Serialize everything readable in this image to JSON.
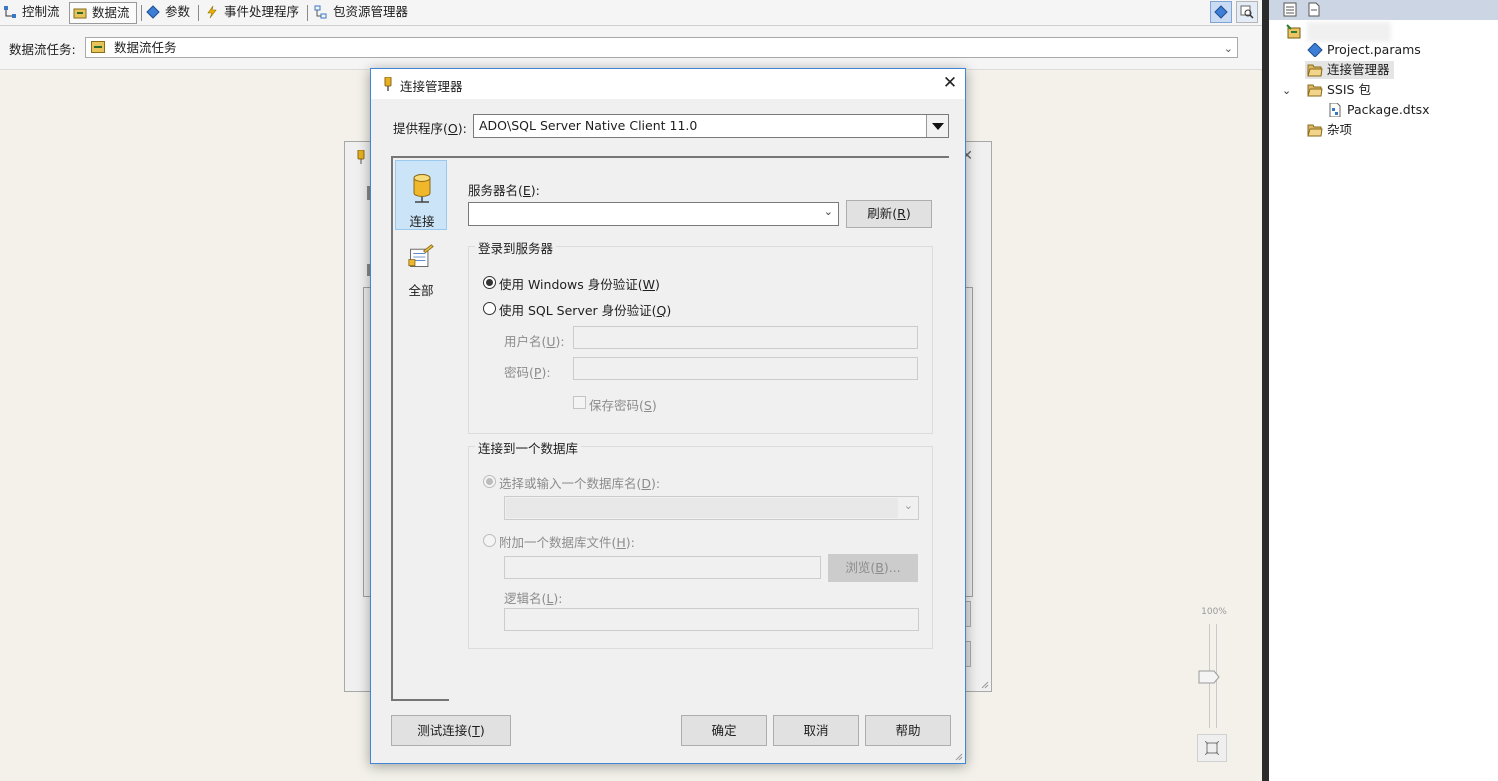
{
  "designer": {
    "tabs": [
      {
        "label": "控制流",
        "icon": "control-flow-icon"
      },
      {
        "label": "数据流",
        "icon": "data-flow-icon"
      },
      {
        "label": "参数",
        "icon": "parameters-icon"
      },
      {
        "label": "事件处理程序",
        "icon": "event-handler-icon"
      },
      {
        "label": "包资源管理器",
        "icon": "package-explorer-icon"
      }
    ],
    "active_tab": "数据流",
    "task_label": "数据流任务:",
    "task_value": "数据流任务",
    "zoom_label": "100%"
  },
  "solution_explorer": {
    "items": [
      {
        "label": "Project.params",
        "icon": "params-icon"
      },
      {
        "label": "连接管理器",
        "icon": "folder-icon",
        "selected": true
      },
      {
        "label": "SSIS 包",
        "icon": "folder-icon",
        "expanded": true
      },
      {
        "label": "Package.dtsx",
        "icon": "package-file-icon"
      },
      {
        "label": "杂项",
        "icon": "folder-icon"
      }
    ]
  },
  "dialog": {
    "title": "连接管理器",
    "provider_label": "提供程序(",
    "provider_key": "O",
    "provider_label_end": "):",
    "provider_value": "ADO\\SQL Server Native Client 11.0",
    "nav": [
      {
        "label": "连接",
        "icon": "database-connection-icon",
        "selected": true
      },
      {
        "label": "全部",
        "icon": "properties-all-icon",
        "selected": false
      }
    ],
    "server_name_label": "服务器名(",
    "server_name_key": "E",
    "server_name_end": "):",
    "server_name_value": "",
    "refresh_label": "刷新(",
    "refresh_key": "R",
    "refresh_end": ")",
    "login_group": {
      "title": "登录到服务器",
      "windows_auth": {
        "label": "使用 Windows 身份验证(",
        "key": "W",
        "end": ")",
        "checked": true
      },
      "sql_auth": {
        "label": "使用 SQL Server 身份验证(",
        "key": "Q",
        "end": ")",
        "checked": false
      },
      "username_label": "用户名(",
      "username_key": "U",
      "username_end": "):",
      "password_label": "密码(",
      "password_key": "P",
      "password_end": "):",
      "save_password": {
        "label": "保存密码(",
        "key": "S",
        "end": ")",
        "checked": false
      }
    },
    "db_group": {
      "title": "连接到一个数据库",
      "select_db": {
        "label": "选择或输入一个数据库名(",
        "key": "D",
        "end": "):",
        "checked": true
      },
      "attach_db": {
        "label": "附加一个数据库文件(",
        "key": "H",
        "end": "):",
        "checked": false
      },
      "browse_label": "浏览(",
      "browse_key": "B",
      "browse_end": ")...",
      "logical_name_label": "逻辑名(",
      "logical_name_key": "L",
      "logical_name_end": "):"
    },
    "buttons": {
      "test": {
        "label": "测试连接(",
        "key": "T",
        "end": ")"
      },
      "ok": "确定",
      "cancel": "取消",
      "help": "帮助"
    }
  }
}
